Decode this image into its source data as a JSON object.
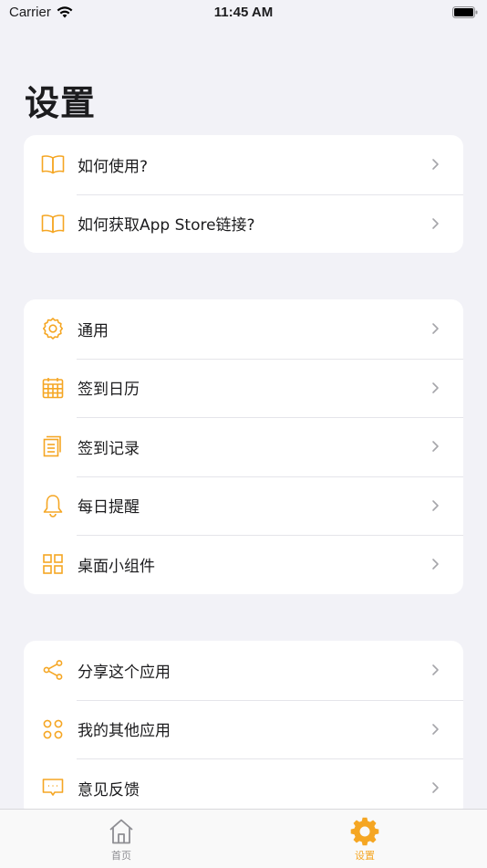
{
  "status_bar": {
    "carrier": "Carrier",
    "time": "11:45 AM"
  },
  "page_title": "设置",
  "accent_color": "#f5a623",
  "groups": [
    {
      "items": [
        {
          "label": "如何使用?",
          "icon": "book-icon"
        },
        {
          "label": "如何获取App Store链接?",
          "icon": "book-icon"
        }
      ]
    },
    {
      "items": [
        {
          "label": "通用",
          "icon": "gear-icon"
        },
        {
          "label": "签到日历",
          "icon": "calendar-icon"
        },
        {
          "label": "签到记录",
          "icon": "document-icon"
        },
        {
          "label": "每日提醒",
          "icon": "bell-icon"
        },
        {
          "label": "桌面小组件",
          "icon": "widget-grid-icon"
        }
      ]
    },
    {
      "items": [
        {
          "label": "分享这个应用",
          "icon": "share-icon"
        },
        {
          "label": "我的其他应用",
          "icon": "apps-circles-icon"
        },
        {
          "label": "意见反馈",
          "icon": "message-icon"
        }
      ]
    }
  ],
  "tabbar": {
    "tabs": [
      {
        "label": "首页",
        "icon": "home-icon",
        "active": false
      },
      {
        "label": "设置",
        "icon": "gear-icon",
        "active": true
      }
    ]
  }
}
